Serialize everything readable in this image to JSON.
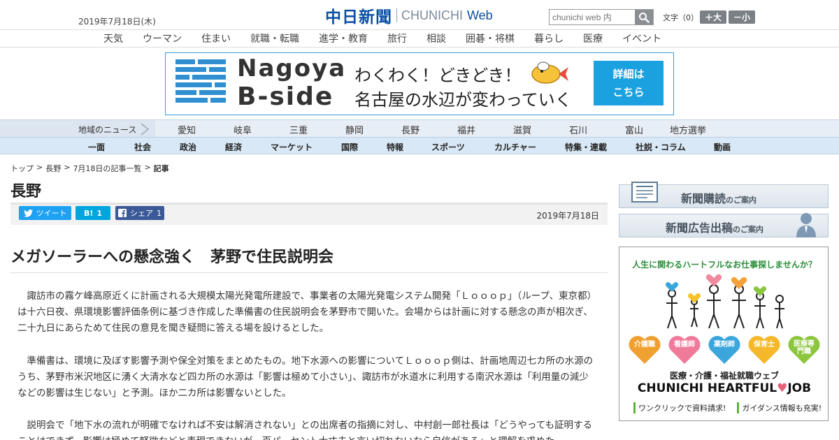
{
  "header": {
    "date": "2019年7月18日(木)",
    "logo_ja": "中日新聞",
    "logo_en": "CHUNICHI",
    "logo_web": "Web",
    "search_placeholder": "chunichi web 内",
    "textsize_label": "文字（0）",
    "size_up": "＋大",
    "size_down": "－小"
  },
  "top_nav": [
    "天気",
    "ウーマン",
    "住まい",
    "就職・転職",
    "進学・教育",
    "旅行",
    "相談",
    "囲碁・将棋",
    "暮らし",
    "医療",
    "イベント"
  ],
  "banner": {
    "title1": "Nagoya",
    "title2": "B-side",
    "line1": "わくわく！どきどき！",
    "line2": "名古屋の水辺が変わっていく",
    "button_line1": "詳細は",
    "button_line2": "こちら"
  },
  "region_nav": {
    "label": "地域のニュース",
    "items": [
      "愛知",
      "岐阜",
      "三重",
      "静岡",
      "長野",
      "福井",
      "滋賀",
      "石川",
      "富山",
      "地方選挙"
    ]
  },
  "section_nav": [
    "一面",
    "社会",
    "政治",
    "経済",
    "マーケット",
    "国際",
    "特報",
    "スポーツ",
    "カルチャー",
    "特集・連載",
    "社説・コラム",
    "動画"
  ],
  "breadcrumb": {
    "items": [
      "トップ",
      ">",
      "長野",
      ">",
      "7月18日の記事一覧",
      ">"
    ],
    "current": "記事"
  },
  "article": {
    "section": "長野",
    "share": {
      "tweet": "ツイート",
      "hatena_label": "B!",
      "hatena_count": "1",
      "facebook": "シェア",
      "facebook_count": "1"
    },
    "date": "2019年7月18日",
    "headline": "メガソーラーへの懸念強く　茅野で住民説明会",
    "paragraphs": [
      "諏訪市の霧ケ峰高原近くに計画される大規模太陽光発電所建設で、事業者の太陽光発電システム開発「Ｌｏｏｏｐ」（ループ、東京都）は十六日夜、県環境影響評価条例に基づき作成した準備書の住民説明会を茅野市で開いた。会場からは計画に対する懸念の声が相次ぎ、二十九日にあらためて住民の意見を聞き疑問に答える場を設けるとした。",
      "準備書は、環境に及ぼす影響予測や保全対策をまとめたもの。地下水源への影響についてＬｏｏｏｐ側は、計画地周辺七カ所の水源のうち、茅野市米沢地区に湧く大清水など四カ所の水源は「影響は極めて小さい」、諏訪市が水道水に利用する南沢水源は「利用量の減少などの影響は生じない」と予測。ほか二カ所は影響ないとした。",
      "説明会で「地下水の流れが明確でなければ不安は解消されない」との出席者の指摘に対し、中村創一郎社長は「どうやっても証明することはできず、影響は極めて軽微などと表現できないが、百パーセント大丈夫と言い切れないなら自信がある」と理解を求めた。"
    ]
  },
  "sidebar": {
    "subscribe": "新聞購読",
    "subscribe_suffix": "のご案内",
    "advertise": "新聞広告出稿",
    "advertise_suffix": "のご案内",
    "job_ad": {
      "tagline": "人生に関わるハートフルなお仕事探しませんか？",
      "roles": [
        "介護職",
        "看護師",
        "薬剤師",
        "保育士",
        "医療専門職"
      ],
      "role_colors": [
        "#f0a030",
        "#f07a9a",
        "#3aa6dc",
        "#f5b82a",
        "#8cc63f"
      ],
      "line1": "医療・介護・福祉就職ウェブ",
      "line2_a": "CHUNICHI HEARTFUL",
      "line2_heart": "♥",
      "line2_b": "JOB",
      "bullet1": "ワンクリックで資料請求!",
      "bullet2": "ガイダンス情報も充実!"
    }
  },
  "colors": {
    "brand_blue": "#0a4fa3",
    "banner_button": "#1ba0e0",
    "twitter": "#1da1f2",
    "hatena": "#00a4de",
    "facebook": "#3b5998"
  }
}
